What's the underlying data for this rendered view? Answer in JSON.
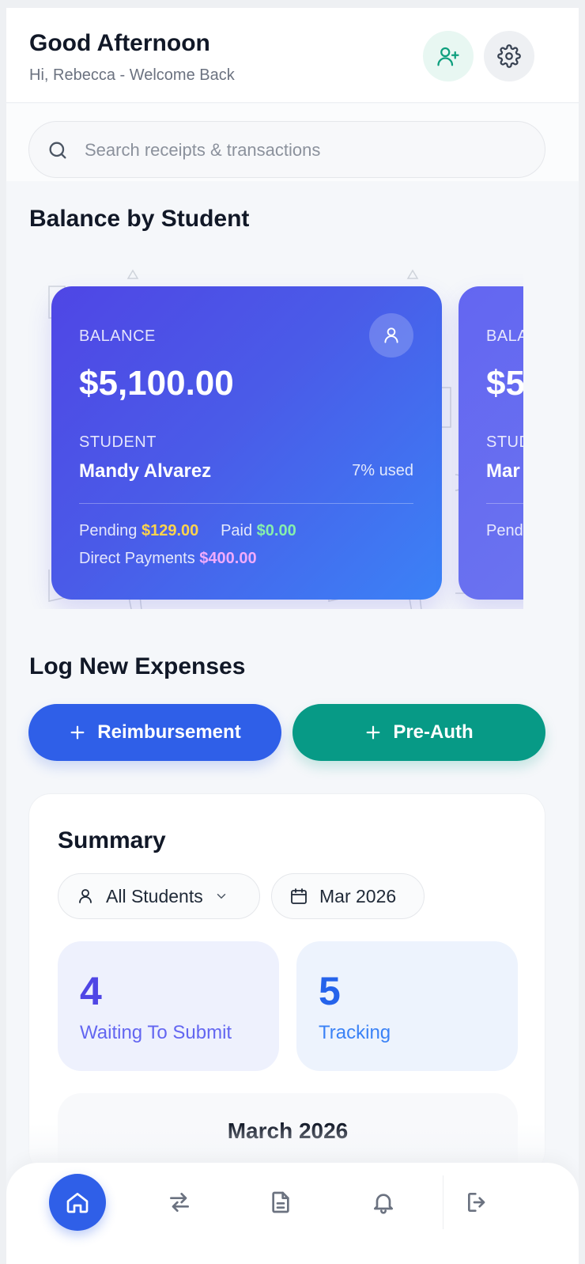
{
  "header": {
    "greeting": "Good Afternoon",
    "subtitle": "Hi, Rebecca - Welcome Back",
    "add_user_icon": "person-plus-icon",
    "settings_icon": "gear-icon"
  },
  "search": {
    "placeholder": "Search receipts & transactions",
    "value": ""
  },
  "balance_section": {
    "title": "Balance by Student",
    "cards": [
      {
        "balance_label": "BALANCE",
        "balance": "$5,100.00",
        "student_label": "STUDENT",
        "student_name": "Mandy Alvarez",
        "used": "7% used",
        "pending_label": "Pending",
        "pending": "$129.00",
        "paid_label": "Paid",
        "paid": "$0.00",
        "direct_label": "Direct Payments",
        "direct": "$400.00"
      },
      {
        "balance_label": "BALA",
        "balance": "$5",
        "student_label": "STUD",
        "student_name": "Mar",
        "pending_label": "Pend"
      }
    ]
  },
  "expenses": {
    "title": "Log New Expenses",
    "reimbursement_label": "Reimbursement",
    "preauth_label": "Pre-Auth"
  },
  "summary": {
    "title": "Summary",
    "student_filter": "All Students",
    "month_filter": "Mar 2026",
    "waiting_count": "4",
    "waiting_label": "Waiting To Submit",
    "tracking_count": "5",
    "tracking_label": "Tracking",
    "calendar_title": "March 2026"
  },
  "colors": {
    "primary": "#2f5fe8",
    "teal": "#079a86",
    "card_gradient_start": "#4f46e5",
    "card_gradient_end": "#3b82f6"
  },
  "nav": {
    "items": [
      "home-icon",
      "transfer-arrows-icon",
      "document-icon",
      "bell-icon",
      "logout-icon"
    ],
    "active": "home-icon"
  }
}
